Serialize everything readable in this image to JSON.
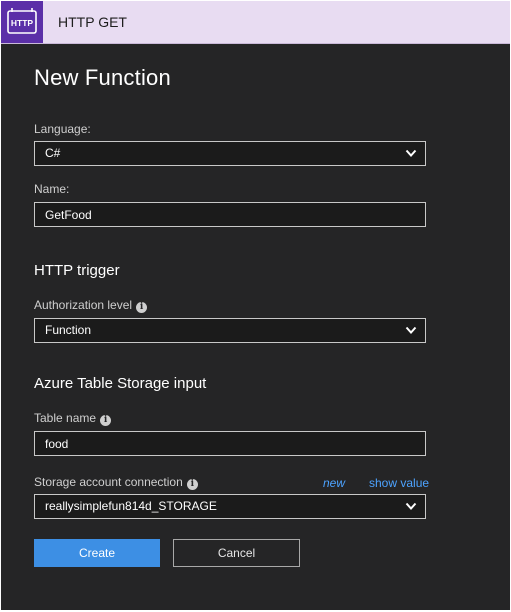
{
  "window": {
    "title": "HTTP GET",
    "icon": "http-icon",
    "icon_text": "HTTP"
  },
  "form": {
    "heading": "New Function",
    "language": {
      "label": "Language:",
      "value": "C#"
    },
    "name": {
      "label": "Name:",
      "value": "GetFood"
    },
    "http_trigger": {
      "heading": "HTTP trigger",
      "auth_label": "Authorization level",
      "auth_value": "Function"
    },
    "table_input": {
      "heading": "Azure Table Storage input",
      "table_name_label": "Table name",
      "table_name_value": "food",
      "connection_label": "Storage account connection",
      "connection_value": "reallysimplefun814d_STORAGE",
      "new_link": "new",
      "show_value_link": "show value"
    }
  },
  "buttons": {
    "create": "Create",
    "cancel": "Cancel"
  },
  "colors": {
    "background": "#252526",
    "titlebar": "#e8dcf2",
    "icon_tile": "#5b2fa8",
    "accent": "#3d8fe4",
    "link": "#4da3ff"
  }
}
